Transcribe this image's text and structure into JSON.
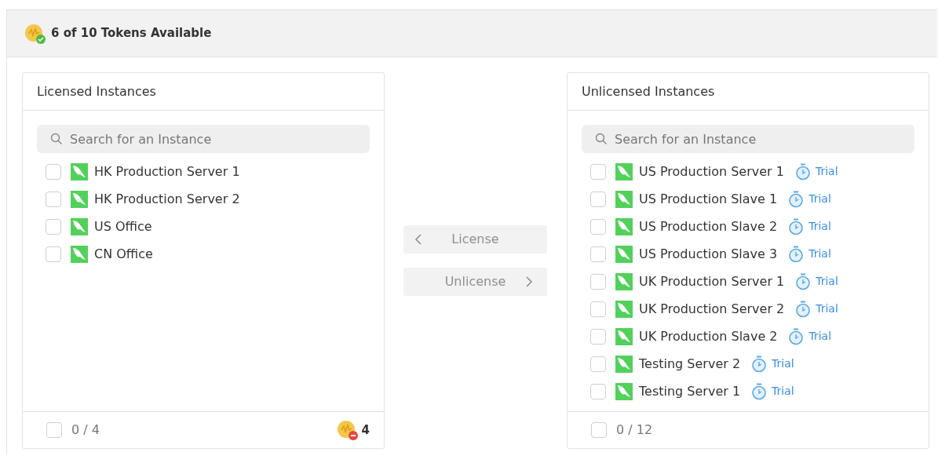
{
  "header": {
    "title": "6 of 10 Tokens Available"
  },
  "licensed": {
    "title": "Licensed Instances",
    "search": {
      "placeholder": "Search for an Instance"
    },
    "items": [
      {
        "name": "HK Production Server 1",
        "checked": false
      },
      {
        "name": "HK Production Server 2",
        "checked": false
      },
      {
        "name": "US Office",
        "checked": false
      },
      {
        "name": "CN Office",
        "checked": false
      }
    ],
    "footer": {
      "count": "0 / 4",
      "checked": false,
      "tokens": "4"
    }
  },
  "actions": [
    {
      "label": "License",
      "kind": "back",
      "disabled": true
    },
    {
      "label": "Unlicense",
      "kind": "forward",
      "disabled": true
    }
  ],
  "unlicensed": {
    "title": "Unlicensed Instances",
    "search": {
      "placeholder": "Search for an Instance"
    },
    "items": [
      {
        "name": "US Production Server 1",
        "checked": false,
        "badge": "Trial"
      },
      {
        "name": "US Production Slave 1",
        "checked": false,
        "badge": "Trial"
      },
      {
        "name": "US Production Slave 2",
        "checked": false,
        "badge": "Trial"
      },
      {
        "name": "US Production Slave 3",
        "checked": false,
        "badge": "Trial"
      },
      {
        "name": "UK Production Server 1",
        "checked": false,
        "badge": "Trial"
      },
      {
        "name": "UK Production Server 2",
        "checked": false,
        "badge": "Trial"
      },
      {
        "name": "UK Production Slave 2",
        "checked": false,
        "badge": "Trial"
      },
      {
        "name": "Testing Server 2",
        "checked": false,
        "badge": "Trial"
      },
      {
        "name": "Testing Server 1",
        "checked": false,
        "badge": "Trial"
      }
    ],
    "footer": {
      "count": "0 / 12",
      "checked": false
    }
  }
}
